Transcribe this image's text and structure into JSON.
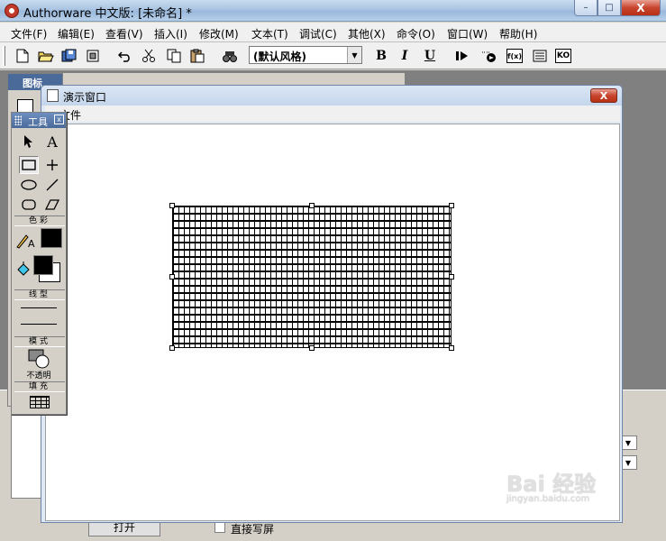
{
  "window": {
    "title": "Authorware 中文版: [未命名] *",
    "controls": {
      "minimize": "–",
      "maximize": "□",
      "close": "X"
    }
  },
  "menubar": {
    "items": [
      {
        "label": "文件(F)"
      },
      {
        "label": "编辑(E)"
      },
      {
        "label": "查看(V)"
      },
      {
        "label": "插入(I)"
      },
      {
        "label": "修改(M)"
      },
      {
        "label": "文本(T)"
      },
      {
        "label": "调试(C)"
      },
      {
        "label": "其他(X)"
      },
      {
        "label": "命令(O)"
      },
      {
        "label": "窗口(W)"
      },
      {
        "label": "帮助(H)"
      }
    ]
  },
  "toolbar": {
    "style_value": "(默认风格)",
    "bold_label": "B",
    "italic_label": "I",
    "underline_label": "U",
    "fn_label": "f(x)",
    "ko_label": "KO"
  },
  "icon_palette": {
    "title": "图标"
  },
  "presentation": {
    "title": "演示窗口",
    "menu_label": "文件",
    "close_label": "X"
  },
  "tools": {
    "title": "工具",
    "text_tool_label": "A",
    "color_label": "色彩",
    "line_label": "线型",
    "mode_label": "模式",
    "mode_value": "不透明",
    "fill_label": "填充",
    "colors": {
      "line": "#000000",
      "foreground": "#000000",
      "background": "#ffffff"
    }
  },
  "bottom_panel": {
    "checkbox_label": "直接写屏",
    "button_label": "打开"
  },
  "watermark": {
    "text": "Bai 经验",
    "url": "jingyan.baidu.com"
  }
}
